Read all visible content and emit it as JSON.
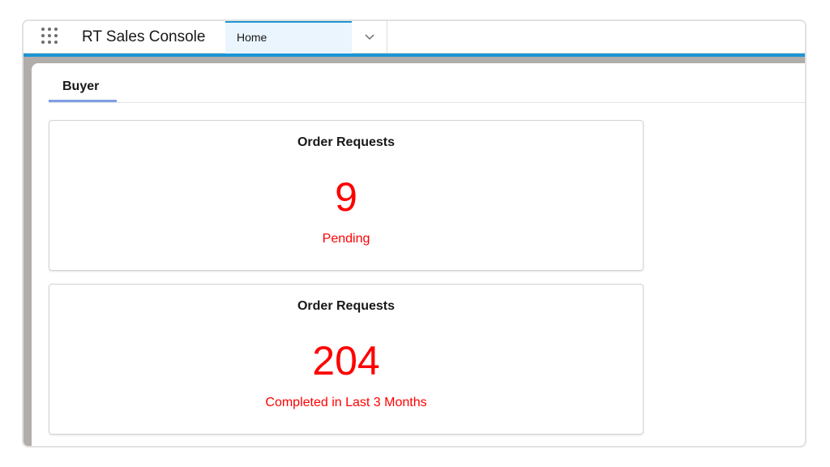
{
  "app": {
    "name": "RT Sales Console",
    "launcher_icon": "app-launcher-grid-icon"
  },
  "nav": {
    "tabs": [
      {
        "label": "Home",
        "active": true
      }
    ],
    "menu_icon": "chevron-down-icon"
  },
  "page": {
    "subtabs": [
      {
        "label": "Buyer",
        "active": true
      }
    ]
  },
  "cards": [
    {
      "title": "Order Requests",
      "value": "9",
      "caption": "Pending"
    },
    {
      "title": "Order Requests",
      "value": "204",
      "caption": "Completed in Last 3 Months"
    }
  ],
  "colors": {
    "brand": "#1b96d4",
    "metric": "#ff0000",
    "active_tab_bg": "#eaf5fe",
    "subtab_underline": "#7f9fe3"
  }
}
